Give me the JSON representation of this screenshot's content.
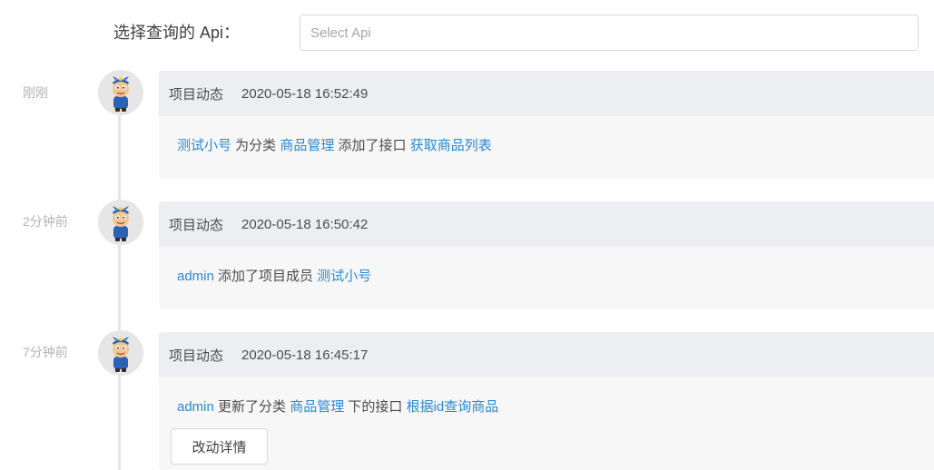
{
  "filter": {
    "label": "选择查询的 Api：",
    "placeholder": "Select Api"
  },
  "entries": [
    {
      "time_ago": "刚刚",
      "type": "项目动态",
      "datetime": "2020-05-18 16:52:49",
      "parts": [
        {
          "text": "测试小号",
          "link": true
        },
        {
          "text": " 为分类 ",
          "link": false
        },
        {
          "text": "商品管理",
          "link": true
        },
        {
          "text": " 添加了接口 ",
          "link": false
        },
        {
          "text": "获取商品列表",
          "link": true
        }
      ]
    },
    {
      "time_ago": "2分钟前",
      "type": "项目动态",
      "datetime": "2020-05-18 16:50:42",
      "parts": [
        {
          "text": "admin",
          "link": true
        },
        {
          "text": " 添加了项目成员 ",
          "link": false
        },
        {
          "text": "测试小号",
          "link": true
        }
      ]
    },
    {
      "time_ago": "7分钟前",
      "type": "项目动态",
      "datetime": "2020-05-18 16:45:17",
      "parts": [
        {
          "text": "admin",
          "link": true
        },
        {
          "text": " 更新了分类 ",
          "link": false
        },
        {
          "text": "商品管理",
          "link": true
        },
        {
          "text": " 下的接口 ",
          "link": false
        },
        {
          "text": "根据id查询商品",
          "link": true
        }
      ],
      "detail_button": "改动详情"
    }
  ],
  "colors": {
    "link": "#2a88d4",
    "card_header": "#eceef2",
    "card_body": "#f7f7f7",
    "timeline": "#e5e5e5"
  }
}
